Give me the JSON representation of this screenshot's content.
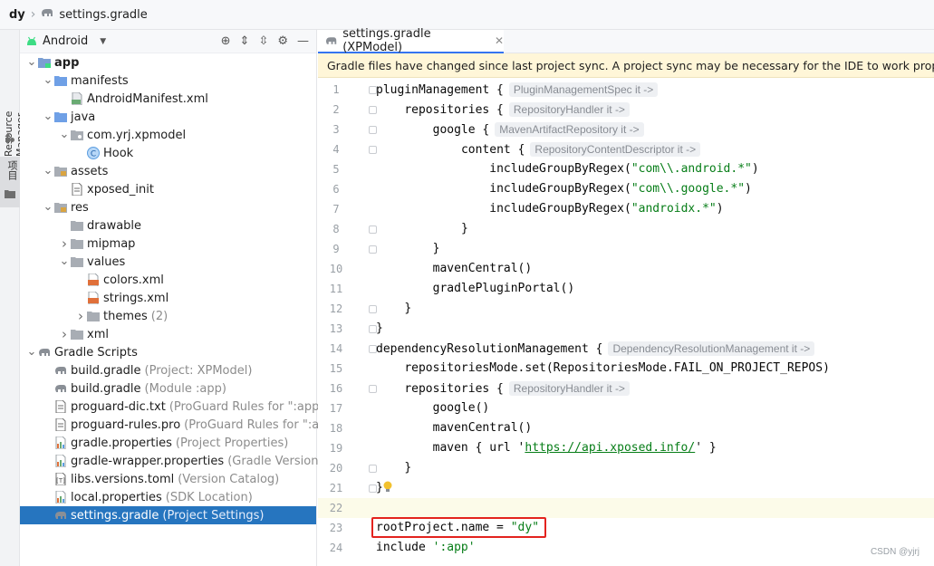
{
  "breadcrumb": {
    "project": "dy",
    "file": "settings.gradle"
  },
  "toolstrip": {
    "resource_manager": "Resource Manager",
    "project_tab": "项目"
  },
  "panel": {
    "view_mode": "Android",
    "tree": [
      {
        "label": "app",
        "hint": "",
        "depth": 0,
        "arrow": "open",
        "icon": "module-folder-icon",
        "bold": true
      },
      {
        "label": "manifests",
        "hint": "",
        "depth": 1,
        "arrow": "open",
        "icon": "folder-blue-icon"
      },
      {
        "label": "AndroidManifest.xml",
        "hint": "",
        "depth": 2,
        "arrow": "none",
        "icon": "manifest-file-icon"
      },
      {
        "label": "java",
        "hint": "",
        "depth": 1,
        "arrow": "open",
        "icon": "folder-blue-icon"
      },
      {
        "label": "com.yrj.xpmodel",
        "hint": "",
        "depth": 2,
        "arrow": "open",
        "icon": "package-folder-icon"
      },
      {
        "label": "Hook",
        "hint": "",
        "depth": 3,
        "arrow": "none",
        "icon": "class-icon"
      },
      {
        "label": "assets",
        "hint": "",
        "depth": 1,
        "arrow": "open",
        "icon": "assets-folder-icon"
      },
      {
        "label": "xposed_init",
        "hint": "",
        "depth": 2,
        "arrow": "none",
        "icon": "text-file-icon"
      },
      {
        "label": "res",
        "hint": "",
        "depth": 1,
        "arrow": "open",
        "icon": "res-folder-icon"
      },
      {
        "label": "drawable",
        "hint": "",
        "depth": 2,
        "arrow": "none",
        "icon": "folder-icon"
      },
      {
        "label": "mipmap",
        "hint": "",
        "depth": 2,
        "arrow": "closed",
        "icon": "folder-icon"
      },
      {
        "label": "values",
        "hint": "",
        "depth": 2,
        "arrow": "open",
        "icon": "folder-icon"
      },
      {
        "label": "colors.xml",
        "hint": "",
        "depth": 3,
        "arrow": "none",
        "icon": "xml-file-icon"
      },
      {
        "label": "strings.xml",
        "hint": "",
        "depth": 3,
        "arrow": "none",
        "icon": "xml-file-icon"
      },
      {
        "label": "themes",
        "hint": "(2)",
        "depth": 3,
        "arrow": "closed",
        "icon": "folder-icon"
      },
      {
        "label": "xml",
        "hint": "",
        "depth": 2,
        "arrow": "closed",
        "icon": "folder-icon"
      },
      {
        "label": "Gradle Scripts",
        "hint": "",
        "depth": 0,
        "arrow": "open",
        "icon": "gradle-elephant-icon"
      },
      {
        "label": "build.gradle",
        "hint": "(Project: XPModel)",
        "depth": 1,
        "arrow": "none",
        "icon": "gradle-elephant-icon"
      },
      {
        "label": "build.gradle",
        "hint": "(Module :app)",
        "depth": 1,
        "arrow": "none",
        "icon": "gradle-elephant-icon"
      },
      {
        "label": "proguard-dic.txt",
        "hint": "(ProGuard Rules for \":app\")",
        "depth": 1,
        "arrow": "none",
        "icon": "text-file-icon"
      },
      {
        "label": "proguard-rules.pro",
        "hint": "(ProGuard Rules for \":app",
        "depth": 1,
        "arrow": "none",
        "icon": "text-file-icon"
      },
      {
        "label": "gradle.properties",
        "hint": "(Project Properties)",
        "depth": 1,
        "arrow": "none",
        "icon": "properties-file-icon"
      },
      {
        "label": "gradle-wrapper.properties",
        "hint": "(Gradle Version)",
        "depth": 1,
        "arrow": "none",
        "icon": "properties-file-icon"
      },
      {
        "label": "libs.versions.toml",
        "hint": "(Version Catalog)",
        "depth": 1,
        "arrow": "none",
        "icon": "toml-file-icon"
      },
      {
        "label": "local.properties",
        "hint": "(SDK Location)",
        "depth": 1,
        "arrow": "none",
        "icon": "properties-file-icon"
      },
      {
        "label": "settings.gradle",
        "hint": "(Project Settings)",
        "depth": 1,
        "arrow": "none",
        "icon": "gradle-elephant-icon",
        "selected": true
      }
    ]
  },
  "editor": {
    "tab_label": "settings.gradle (XPModel)",
    "notice": "Gradle files have changed since last project sync. A project sync may be necessary for the IDE to work properly.",
    "lines": [
      {
        "num": "1",
        "indent": 0,
        "parts": [
          {
            "t": "pluginManagement {"
          }
        ],
        "inlay": "PluginManagementSpec it ->",
        "fold": true
      },
      {
        "num": "2",
        "indent": 4,
        "parts": [
          {
            "t": "repositories {"
          }
        ],
        "inlay": "RepositoryHandler it ->",
        "fold": true
      },
      {
        "num": "3",
        "indent": 8,
        "parts": [
          {
            "t": "google {"
          }
        ],
        "inlay": "MavenArtifactRepository it ->",
        "fold": true
      },
      {
        "num": "4",
        "indent": 12,
        "parts": [
          {
            "t": "content {"
          }
        ],
        "inlay": "RepositoryContentDescriptor it ->",
        "fold": true
      },
      {
        "num": "5",
        "indent": 16,
        "parts": [
          {
            "t": "includeGroupByRegex("
          },
          {
            "t": "\"com\\\\.android.*\"",
            "c": "str"
          },
          {
            "t": ")"
          }
        ]
      },
      {
        "num": "6",
        "indent": 16,
        "parts": [
          {
            "t": "includeGroupByRegex("
          },
          {
            "t": "\"com\\\\.google.*\"",
            "c": "str"
          },
          {
            "t": ")"
          }
        ]
      },
      {
        "num": "7",
        "indent": 16,
        "parts": [
          {
            "t": "includeGroupByRegex("
          },
          {
            "t": "\"androidx.*\"",
            "c": "str"
          },
          {
            "t": ")"
          }
        ]
      },
      {
        "num": "8",
        "indent": 12,
        "parts": [
          {
            "t": "}"
          }
        ],
        "fold": true
      },
      {
        "num": "9",
        "indent": 8,
        "parts": [
          {
            "t": "}"
          }
        ],
        "fold": true
      },
      {
        "num": "10",
        "indent": 8,
        "parts": [
          {
            "t": "mavenCentral()"
          }
        ]
      },
      {
        "num": "11",
        "indent": 8,
        "parts": [
          {
            "t": "gradlePluginPortal()"
          }
        ]
      },
      {
        "num": "12",
        "indent": 4,
        "parts": [
          {
            "t": "}"
          }
        ],
        "fold": true
      },
      {
        "num": "13",
        "indent": 0,
        "parts": [
          {
            "t": "}"
          }
        ],
        "fold": true
      },
      {
        "num": "14",
        "indent": 0,
        "parts": [
          {
            "t": "dependencyResolutionManagement {"
          }
        ],
        "inlay": "DependencyResolutionManagement it ->",
        "fold": true
      },
      {
        "num": "15",
        "indent": 4,
        "parts": [
          {
            "t": "repositoriesMode.set(RepositoriesMode.FAIL_ON_PROJECT_REPOS)"
          }
        ]
      },
      {
        "num": "16",
        "indent": 4,
        "parts": [
          {
            "t": "repositories {"
          }
        ],
        "inlay": "RepositoryHandler it ->",
        "fold": true
      },
      {
        "num": "17",
        "indent": 8,
        "parts": [
          {
            "t": "google()"
          }
        ]
      },
      {
        "num": "18",
        "indent": 8,
        "parts": [
          {
            "t": "mavenCentral()"
          }
        ]
      },
      {
        "num": "19",
        "indent": 8,
        "parts": [
          {
            "t": "maven { url '"
          },
          {
            "t": "https://api.xposed.info/",
            "c": "url"
          },
          {
            "t": "' }"
          }
        ]
      },
      {
        "num": "20",
        "indent": 4,
        "parts": [
          {
            "t": "}"
          }
        ],
        "fold": true
      },
      {
        "num": "21",
        "indent": 0,
        "parts": [
          {
            "t": "}"
          }
        ],
        "fold": true,
        "bulb": true
      },
      {
        "num": "22",
        "indent": 0,
        "parts": [],
        "caret": true
      },
      {
        "num": "23",
        "indent": 0,
        "parts": [
          {
            "t": "rootProject.name = "
          },
          {
            "t": "\"dy\"",
            "c": "str"
          }
        ]
      },
      {
        "num": "24",
        "indent": 0,
        "parts": [
          {
            "t": "include "
          },
          {
            "t": "':app'",
            "c": "str"
          }
        ]
      }
    ]
  },
  "watermark": "CSDN @yjrj",
  "colors": {
    "selection": "#2675bf",
    "notice_bg": "#fff6d8",
    "highlight_box": "#e3231e",
    "string": "#067d17"
  }
}
